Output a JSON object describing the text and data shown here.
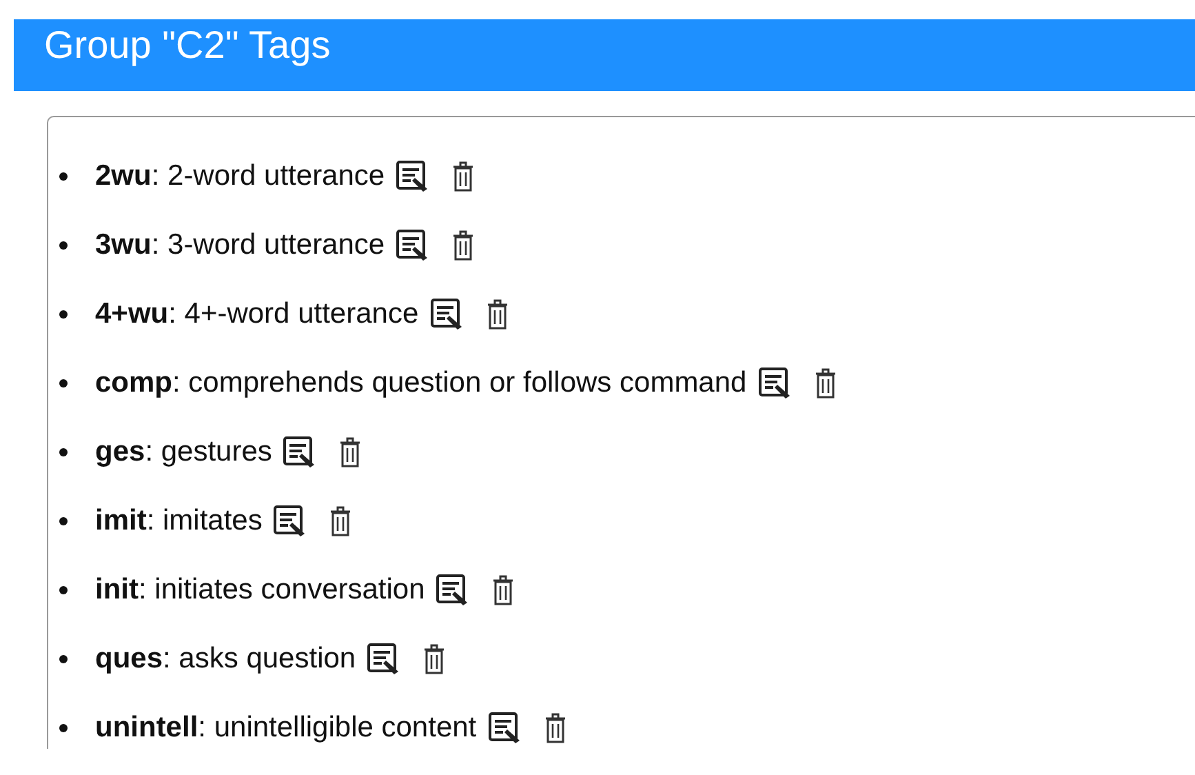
{
  "header": {
    "title": "Group \"C2\" Tags"
  },
  "tags": [
    {
      "text": "**2wu**: 2-word utterance"
    },
    {
      "text": "**3wu**: 3-word utterance"
    },
    {
      "text": "**4+wu**: 4+-word utterance"
    },
    {
      "text": "**comp**: comprehends question or follows command"
    },
    {
      "text": "**ges**: gestures"
    },
    {
      "text": "**imit**: imitates"
    },
    {
      "text": "**init**: initiates conversation"
    },
    {
      "text": "**ques**: asks question"
    },
    {
      "text": "**unintell**: unintelligible content"
    }
  ]
}
